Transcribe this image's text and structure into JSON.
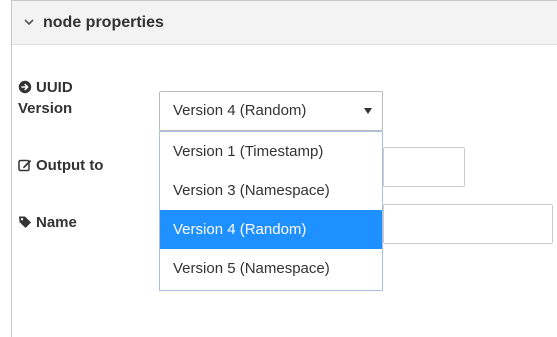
{
  "header": {
    "title": "node properties",
    "toggle_icon": "chevron-down-icon"
  },
  "fields": {
    "uuid_version": {
      "label_line1": "UUID",
      "label_line2": "Version",
      "icon": "arrow-circle-right-icon",
      "selected_value": "Version 4 (Random)"
    },
    "output_to": {
      "label": "Output to",
      "icon": "edit-icon"
    },
    "name": {
      "label": "Name",
      "icon": "tag-icon"
    }
  },
  "dropdown": {
    "options": [
      "Version 1 (Timestamp)",
      "Version 3 (Namespace)",
      "Version 4 (Random)",
      "Version 5 (Namespace)"
    ],
    "selected_index": 2
  },
  "colors": {
    "selected_bg": "#1e90ff",
    "header_bg": "#f3f3f3"
  }
}
